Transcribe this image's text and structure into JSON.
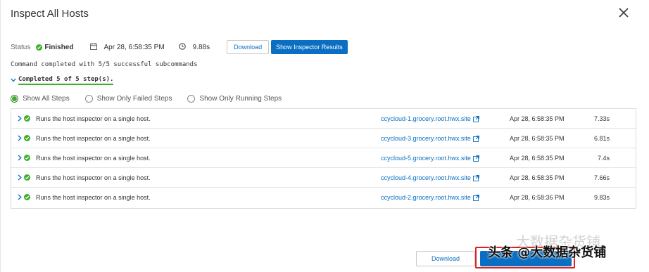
{
  "modal": {
    "title": "Inspect All Hosts"
  },
  "status": {
    "label": "Status",
    "state": "Finished",
    "date": "Apr 28, 6:58:35 PM",
    "duration": "9.88s",
    "download_label": "Download",
    "show_results_label": "Show Inspector Results"
  },
  "command_text": "Command completed with 5/5 successful subcommands",
  "completed_text": "Completed 5 of 5 step(s).",
  "filters": [
    {
      "label": "Show All Steps",
      "checked": true
    },
    {
      "label": "Show Only Failed Steps",
      "checked": false
    },
    {
      "label": "Show Only Running Steps",
      "checked": false
    }
  ],
  "steps": [
    {
      "desc": "Runs the host inspector on a single host.",
      "host": "ccycloud-1.grocery.root.hwx.site",
      "time": "Apr 28, 6:58:35 PM",
      "duration": "7.33s"
    },
    {
      "desc": "Runs the host inspector on a single host.",
      "host": "ccycloud-3.grocery.root.hwx.site",
      "time": "Apr 28, 6:58:35 PM",
      "duration": "6.81s"
    },
    {
      "desc": "Runs the host inspector on a single host.",
      "host": "ccycloud-5.grocery.root.hwx.site",
      "time": "Apr 28, 6:58:35 PM",
      "duration": "7.4s"
    },
    {
      "desc": "Runs the host inspector on a single host.",
      "host": "ccycloud-4.grocery.root.hwx.site",
      "time": "Apr 28, 6:58:35 PM",
      "duration": "7.66s"
    },
    {
      "desc": "Runs the host inspector on a single host.",
      "host": "ccycloud-2.grocery.root.hwx.site",
      "time": "Apr 28, 6:58:36 PM",
      "duration": "9.83s"
    }
  ],
  "footer": {
    "download_label": "Download",
    "close_label": ""
  },
  "watermark": {
    "main": "头条 @大数据杂货铺",
    "faint": "大数据杂货铺"
  },
  "colors": {
    "accent": "#0a6fc2",
    "success": "#3dae2b",
    "highlight": "#e02020"
  }
}
